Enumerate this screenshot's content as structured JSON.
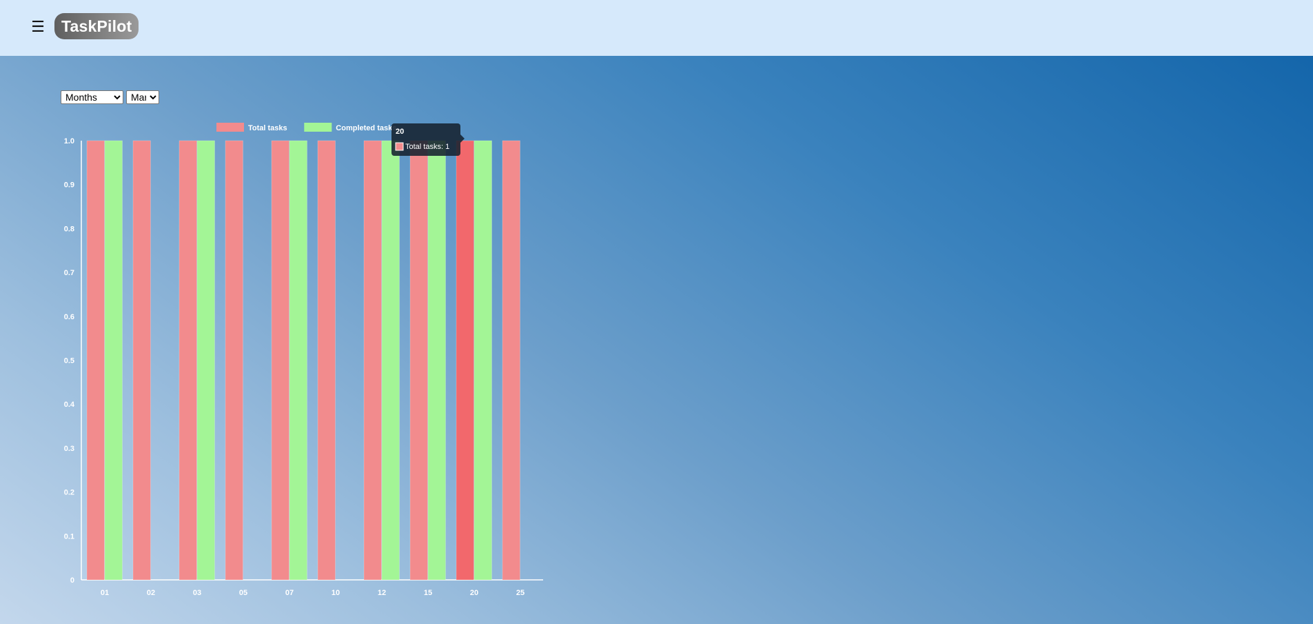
{
  "app": {
    "title": "TaskPilot",
    "menu_icon": "hamburger-icon"
  },
  "controls": {
    "period": {
      "selected": "Months",
      "options": [
        "Months"
      ]
    },
    "month": {
      "selected": "Mar",
      "options": [
        "Mar"
      ]
    }
  },
  "chart_data": {
    "type": "bar",
    "categories": [
      "01",
      "02",
      "03",
      "05",
      "07",
      "10",
      "12",
      "15",
      "20",
      "25"
    ],
    "series": [
      {
        "name": "Total tasks",
        "values": [
          1,
          1,
          1,
          1,
          1,
          1,
          1,
          1,
          1,
          1
        ],
        "color": "#f28b8d",
        "hover_color": "#f2686c"
      },
      {
        "name": "Completed tasks",
        "values": [
          1,
          0,
          1,
          0,
          1,
          0,
          1,
          1,
          1,
          0
        ],
        "color": "#a3f596"
      }
    ],
    "ylim": [
      0,
      1
    ],
    "yticks": [
      "0",
      "0.1",
      "0.2",
      "0.3",
      "0.4",
      "0.5",
      "0.6",
      "0.7",
      "0.8",
      "0.9",
      "1.0"
    ],
    "legend": "top-center",
    "grid": false,
    "axis_color": "#ffffff",
    "tooltip": {
      "title": "20",
      "series_label": "Total tasks",
      "value": 1,
      "text": "Total tasks: 1",
      "category": "20",
      "series_index": 0
    }
  }
}
